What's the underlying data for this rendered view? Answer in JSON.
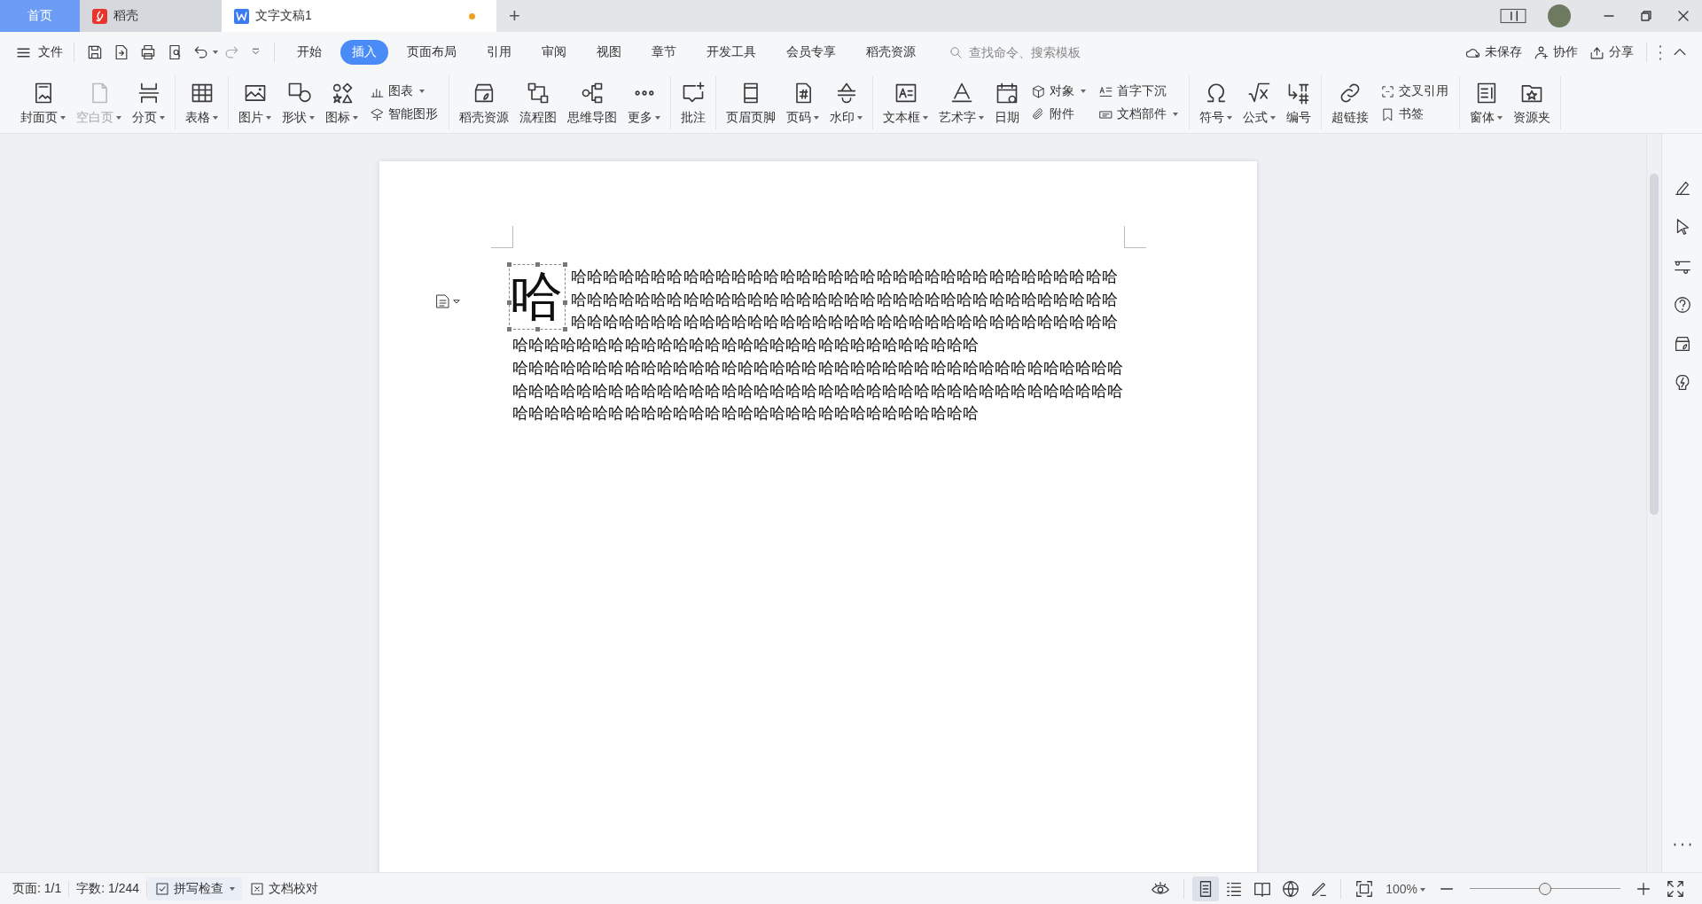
{
  "tabs": [
    {
      "kind": "home",
      "label": "首页",
      "selected": false,
      "modified": false
    },
    {
      "kind": "app",
      "label": "稻壳",
      "selected": false,
      "modified": false
    },
    {
      "kind": "doc",
      "label": "文字文稿1",
      "selected": true,
      "modified": true
    }
  ],
  "new_tab": "+",
  "menu": {
    "file": "文件",
    "tabs": [
      {
        "label": "开始",
        "selected": false
      },
      {
        "label": "插入",
        "selected": true
      },
      {
        "label": "页面布局",
        "selected": false
      },
      {
        "label": "引用",
        "selected": false
      },
      {
        "label": "审阅",
        "selected": false
      },
      {
        "label": "视图",
        "selected": false
      },
      {
        "label": "章节",
        "selected": false
      },
      {
        "label": "开发工具",
        "selected": false
      },
      {
        "label": "会员专享",
        "selected": false
      },
      {
        "label": "稻壳资源",
        "selected": false
      }
    ],
    "search": {
      "placeholder": "查找命令、搜索模板"
    },
    "actions": [
      "未保存",
      "协作",
      "分享"
    ]
  },
  "ribbon": {
    "groups": [
      {
        "items": [
          {
            "kind": "large",
            "label": "封面页",
            "dropdown": true,
            "disabled": false
          },
          {
            "kind": "large",
            "label": "空白页",
            "dropdown": true,
            "disabled": true
          },
          {
            "kind": "large",
            "label": "分页",
            "dropdown": true,
            "disabled": false
          }
        ]
      },
      {
        "items": [
          {
            "kind": "large",
            "label": "表格",
            "dropdown": true,
            "disabled": false
          }
        ]
      },
      {
        "items": [
          {
            "kind": "large",
            "label": "图片",
            "dropdown": true,
            "disabled": false
          },
          {
            "kind": "large",
            "label": "形状",
            "dropdown": true,
            "disabled": false
          },
          {
            "kind": "large",
            "label": "图标",
            "dropdown": true,
            "disabled": false
          },
          {
            "kind": "stack",
            "items": [
              {
                "label": "图表",
                "dropdown": true
              },
              {
                "label": "智能图形",
                "dropdown": false
              }
            ]
          }
        ]
      },
      {
        "items": [
          {
            "kind": "large",
            "label": "稻壳资源",
            "dropdown": false,
            "disabled": false
          },
          {
            "kind": "large",
            "label": "流程图",
            "dropdown": false,
            "disabled": false
          },
          {
            "kind": "large",
            "label": "思维导图",
            "dropdown": false,
            "disabled": false
          },
          {
            "kind": "large",
            "label": "更多",
            "dropdown": true,
            "disabled": false
          }
        ]
      },
      {
        "items": [
          {
            "kind": "large",
            "label": "批注",
            "dropdown": false,
            "disabled": false
          }
        ]
      },
      {
        "items": [
          {
            "kind": "large",
            "label": "页眉页脚",
            "dropdown": false,
            "disabled": false
          },
          {
            "kind": "large",
            "label": "页码",
            "dropdown": true,
            "disabled": false
          },
          {
            "kind": "large",
            "label": "水印",
            "dropdown": true,
            "disabled": false
          }
        ]
      },
      {
        "items": [
          {
            "kind": "large",
            "label": "文本框",
            "dropdown": true,
            "disabled": false
          },
          {
            "kind": "large",
            "label": "艺术字",
            "dropdown": true,
            "disabled": false
          },
          {
            "kind": "large",
            "label": "日期",
            "dropdown": false,
            "disabled": false
          },
          {
            "kind": "stack",
            "items": [
              {
                "label": "对象",
                "dropdown": true
              },
              {
                "label": "附件",
                "dropdown": false
              }
            ]
          },
          {
            "kind": "stack",
            "items": [
              {
                "label": "首字下沉",
                "dropdown": false
              },
              {
                "label": "文档部件",
                "dropdown": true
              }
            ]
          }
        ]
      },
      {
        "items": [
          {
            "kind": "large",
            "label": "符号",
            "dropdown": true,
            "disabled": false
          },
          {
            "kind": "large",
            "label": "公式",
            "dropdown": true,
            "disabled": false
          },
          {
            "kind": "large",
            "label": "编号",
            "dropdown": false,
            "disabled": false
          }
        ]
      },
      {
        "items": [
          {
            "kind": "large",
            "label": "超链接",
            "dropdown": false,
            "disabled": false
          },
          {
            "kind": "stack",
            "items": [
              {
                "label": "交叉引用",
                "dropdown": false
              },
              {
                "label": "书签",
                "dropdown": false
              }
            ]
          }
        ]
      },
      {
        "items": [
          {
            "kind": "large",
            "label": "窗体",
            "dropdown": true,
            "disabled": false
          },
          {
            "kind": "large",
            "label": "资源夹",
            "dropdown": false,
            "disabled": false
          }
        ]
      }
    ]
  },
  "document": {
    "paragraphs": [
      {
        "drop_cap": "哈",
        "text_beside": "哈哈哈哈哈哈哈哈哈哈哈哈哈哈哈哈哈哈哈哈哈哈哈哈哈哈哈哈哈哈哈哈哈哈哈哈哈哈哈哈哈哈哈哈哈哈哈哈哈哈哈哈哈哈哈哈哈哈哈哈哈哈哈哈哈哈哈哈哈哈哈哈哈哈哈哈哈哈哈哈哈哈哈哈哈哈哈哈哈哈哈哈哈哈哈哈哈哈哈哈哈哈",
        "text_below": "哈哈哈哈哈哈哈哈哈哈哈哈哈哈哈哈哈哈哈哈哈哈哈哈哈哈哈哈哈"
      },
      {
        "text": "哈哈哈哈哈哈哈哈哈哈哈哈哈哈哈哈哈哈哈哈哈哈哈哈哈哈哈哈哈哈哈哈哈哈哈哈哈哈哈哈哈哈哈哈哈哈哈哈哈哈哈哈哈哈哈哈哈哈哈哈哈哈哈哈哈哈哈哈哈哈哈哈哈哈哈哈哈哈哈哈哈哈哈哈哈哈哈哈哈哈哈哈哈哈哈哈哈哈哈哈哈哈哈哈哈"
      }
    ]
  },
  "status_bar": {
    "items": [
      "页面: 1/1",
      "字数: 1/244"
    ],
    "spell_check": "拼写检查",
    "proofread": "文档校对",
    "views": [
      {
        "selected": true
      },
      {
        "selected": false
      },
      {
        "selected": false
      },
      {
        "selected": false
      },
      {
        "selected": false
      }
    ],
    "zoom": "100%",
    "zoom_slider": {
      "level": 0.5
    }
  }
}
